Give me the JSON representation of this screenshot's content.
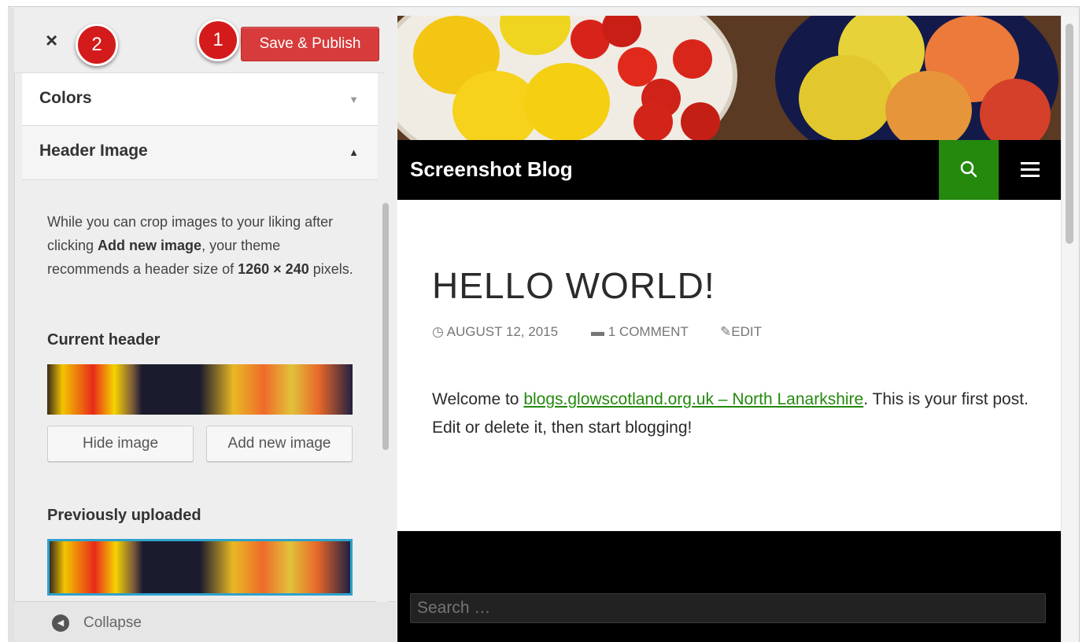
{
  "sidebar": {
    "close_label": "×",
    "save_publish": "Save & Publish",
    "callout_1": "1",
    "callout_2": "2",
    "colors_section": "Colors",
    "header_image_section": "Header Image",
    "description": {
      "part1": "While you can crop images to your liking after clicking ",
      "bold1": "Add new image",
      "part2": ", your theme recommends a header size of ",
      "bold2": "1260 × 240",
      "part3": " pixels."
    },
    "current_header_label": "Current header",
    "hide_image_button": "Hide image",
    "add_new_image_button": "Add new image",
    "previously_uploaded_label": "Previously uploaded",
    "collapse_label": "Collapse"
  },
  "preview": {
    "site_title": "Screenshot Blog",
    "post_title": "HELLO WORLD!",
    "meta": {
      "date": "AUGUST 12, 2015",
      "comments": "1 COMMENT",
      "edit": "EDIT"
    },
    "body": {
      "prefix": "Welcome to ",
      "link": "blogs.glowscotland.org.uk – North Lanarkshire",
      "suffix": ". This is your first post. Edit or delete it, then start blogging!"
    },
    "footer_search_placeholder": "Search …"
  },
  "icons": {
    "close": "close-icon",
    "collapse": "collapse-arrow-icon",
    "search": "search-icon",
    "menu": "menu-icon",
    "clock": "clock-icon",
    "comment": "comment-icon",
    "edit": "pencil-icon"
  },
  "colors": {
    "save_button": "#d73b3b",
    "callout": "#d41b1b",
    "link_green": "#24890d",
    "selected_border": "#2ea2cc"
  }
}
